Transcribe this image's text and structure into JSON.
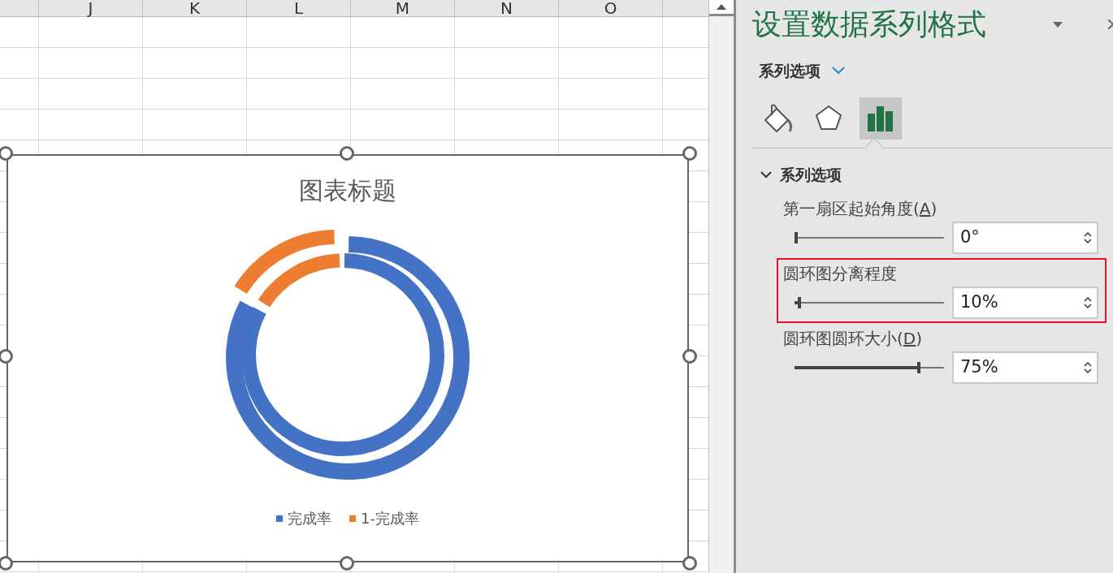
{
  "sheet": {
    "columns": [
      "J",
      "K",
      "L",
      "M",
      "N",
      "O"
    ]
  },
  "chart": {
    "title": "图表标题",
    "selected": true,
    "legend": [
      {
        "label": "完成率",
        "color": "#4472c4"
      },
      {
        "label": "1-完成率",
        "color": "#ed7d31"
      }
    ]
  },
  "panel": {
    "title": "设置数据系列格式",
    "subtitle": "系列选项",
    "icon_tabs": [
      {
        "kind": "fill",
        "selected": false
      },
      {
        "kind": "effects",
        "selected": false
      },
      {
        "kind": "series",
        "selected": true
      }
    ],
    "section": {
      "title": "系列选项",
      "expanded": true,
      "settings": [
        {
          "label": "第一扇区起始角度(A)",
          "underlined_key": true,
          "level": 0,
          "value": "0°",
          "highlighted": false
        },
        {
          "label": "圆环图分离程度",
          "underlined_key": false,
          "level": 0.03,
          "value": "10%",
          "highlighted": true
        },
        {
          "label": "圆环图圆环大小(D)",
          "underlined_key": true,
          "level": 0.83,
          "value": "75%",
          "highlighted": false
        }
      ]
    }
  }
}
